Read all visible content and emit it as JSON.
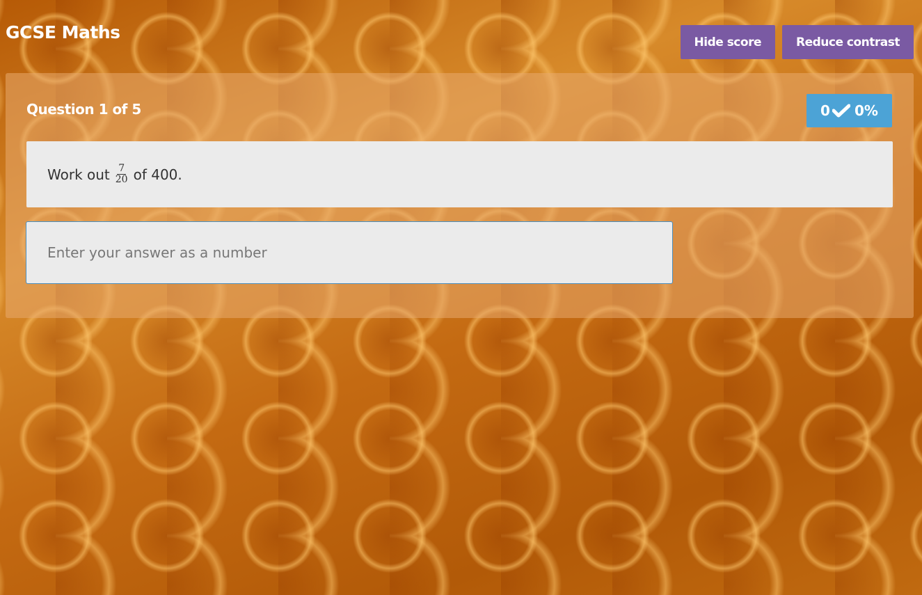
{
  "header": {
    "title": "GCSE Maths",
    "buttons": {
      "hide_score": "Hide score",
      "reduce_contrast": "Reduce contrast"
    }
  },
  "quiz": {
    "counter": "Question 1 of 5",
    "score": {
      "correct": "0",
      "percent": "0%",
      "icon": "check-icon"
    },
    "question": {
      "prefix": "Work out",
      "numerator": "7",
      "denominator": "20",
      "suffix": "of 400."
    },
    "answer": {
      "value": "",
      "placeholder": "Enter your answer as a number"
    }
  },
  "colors": {
    "button_purple": "#7a5aa3",
    "score_blue": "#4ca3d6",
    "panel_bg": "#ebebeb",
    "input_border": "#4a8fbf"
  }
}
